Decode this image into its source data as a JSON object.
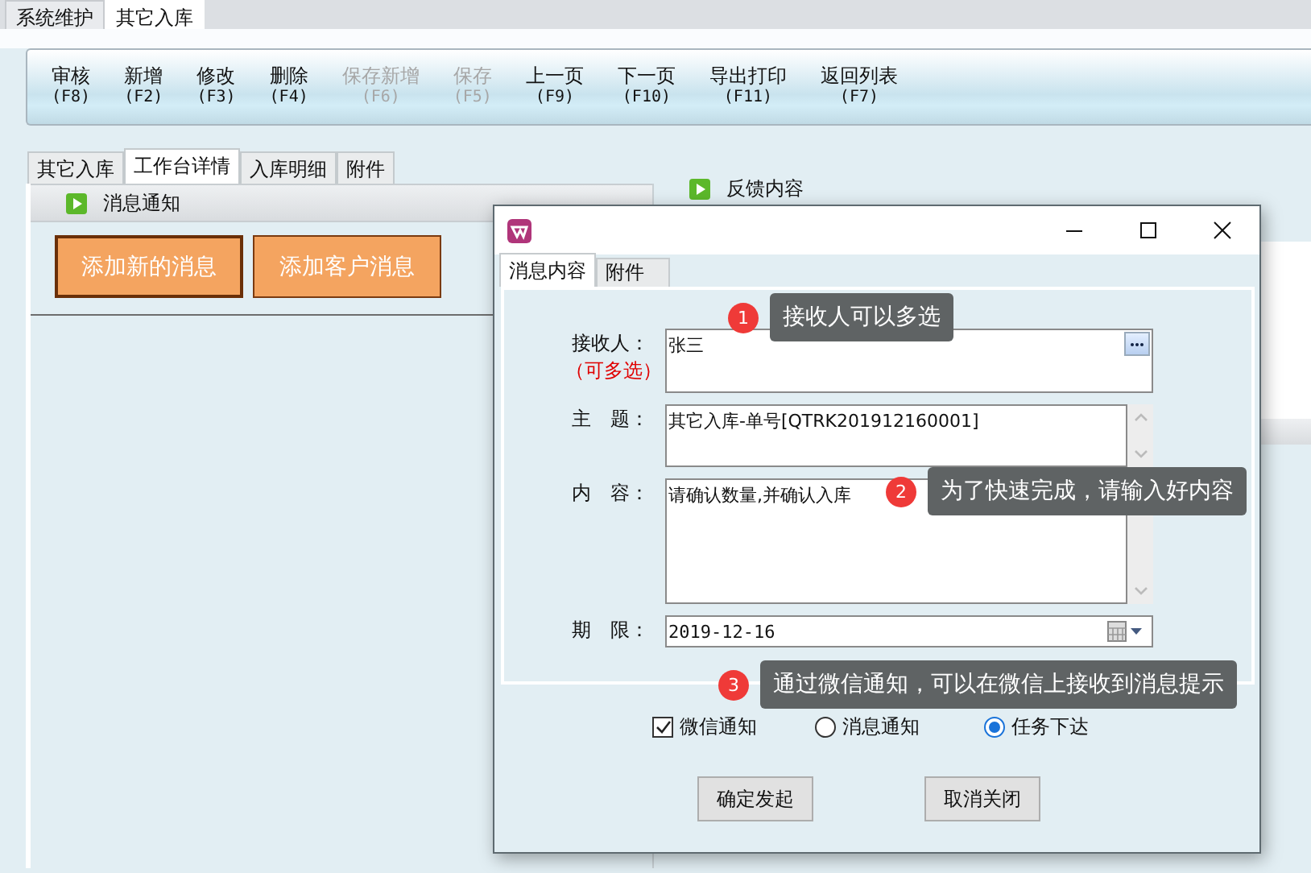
{
  "top_tabs": [
    {
      "label": "系统维护",
      "selected": false
    },
    {
      "label": "其它入库",
      "selected": true
    }
  ],
  "toolbar": [
    {
      "label": "审核",
      "key": "(F8)",
      "disabled": false
    },
    {
      "label": "新增",
      "key": "(F2)",
      "disabled": false
    },
    {
      "label": "修改",
      "key": "(F3)",
      "disabled": false
    },
    {
      "label": "删除",
      "key": "(F4)",
      "disabled": false
    },
    {
      "label": "保存新增",
      "key": "(F6)",
      "disabled": true
    },
    {
      "label": "保存",
      "key": "(F5)",
      "disabled": true
    },
    {
      "label": "上一页",
      "key": "(F9)",
      "disabled": false
    },
    {
      "label": "下一页",
      "key": "(F10)",
      "disabled": false
    },
    {
      "label": "导出打印",
      "key": "(F11)",
      "disabled": false
    },
    {
      "label": "返回列表",
      "key": "(F7)",
      "disabled": false
    }
  ],
  "detail_tabs": [
    {
      "label": "其它入库",
      "selected": false
    },
    {
      "label": "工作台详情",
      "selected": true
    },
    {
      "label": "入库明细",
      "selected": false
    },
    {
      "label": "附件",
      "selected": false
    }
  ],
  "left_panel": {
    "title": "消息通知",
    "buttons": [
      {
        "label": "添加新的消息",
        "focused": true
      },
      {
        "label": "添加客户消息",
        "focused": false
      }
    ]
  },
  "right_panel": {
    "title": "反馈内容"
  },
  "dialog": {
    "tabs": [
      {
        "label": "消息内容",
        "selected": true
      },
      {
        "label": "附件",
        "selected": false
      }
    ],
    "fields": [
      {
        "kind": "picker",
        "label": "接收人：",
        "note": "（可多选）",
        "value": "张三"
      },
      {
        "kind": "memo",
        "label": "主　题：",
        "value": "其它入库-单号[QTRK201912160001]"
      },
      {
        "kind": "memo",
        "label": "内　容：",
        "value": "请确认数量,并确认入库"
      },
      {
        "kind": "date",
        "label": "期　限：",
        "value": "2019-12-16"
      }
    ],
    "options": [
      {
        "kind": "checkbox",
        "label": "微信通知",
        "checked": true
      },
      {
        "kind": "radio",
        "label": "消息通知",
        "selected": false
      },
      {
        "kind": "radio",
        "label": "任务下达",
        "selected": true
      }
    ],
    "buttons": [
      "确定发起",
      "取消关闭"
    ]
  },
  "callouts": [
    {
      "number": "1",
      "text": "接收人可以多选"
    },
    {
      "number": "2",
      "text": "为了快速完成，请输入好内容"
    },
    {
      "number": "3",
      "text": "通过微信通知，可以在微信上接收到消息提示"
    }
  ]
}
